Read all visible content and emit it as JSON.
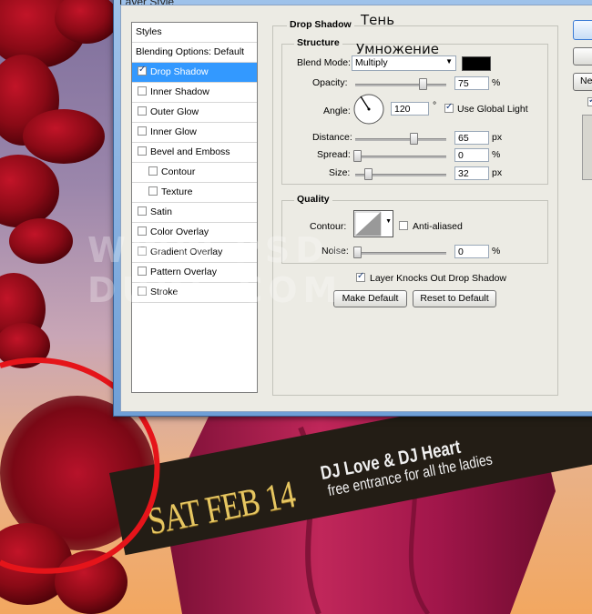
{
  "dialog": {
    "title": "Layer Style"
  },
  "styles_panel": {
    "items": [
      {
        "label": "Styles",
        "checkbox": false,
        "checked": false,
        "selected": false,
        "indent": false
      },
      {
        "label": "Blending Options: Default",
        "checkbox": false,
        "checked": false,
        "selected": false,
        "indent": false
      },
      {
        "label": "Drop Shadow",
        "checkbox": true,
        "checked": true,
        "selected": true,
        "indent": false
      },
      {
        "label": "Inner Shadow",
        "checkbox": true,
        "checked": false,
        "selected": false,
        "indent": false
      },
      {
        "label": "Outer Glow",
        "checkbox": true,
        "checked": false,
        "selected": false,
        "indent": false
      },
      {
        "label": "Inner Glow",
        "checkbox": true,
        "checked": false,
        "selected": false,
        "indent": false
      },
      {
        "label": "Bevel and Emboss",
        "checkbox": true,
        "checked": false,
        "selected": false,
        "indent": false
      },
      {
        "label": "Contour",
        "checkbox": true,
        "checked": false,
        "selected": false,
        "indent": true
      },
      {
        "label": "Texture",
        "checkbox": true,
        "checked": false,
        "selected": false,
        "indent": true
      },
      {
        "label": "Satin",
        "checkbox": true,
        "checked": false,
        "selected": false,
        "indent": false
      },
      {
        "label": "Color Overlay",
        "checkbox": true,
        "checked": false,
        "selected": false,
        "indent": false
      },
      {
        "label": "Gradient Overlay",
        "checkbox": true,
        "checked": false,
        "selected": false,
        "indent": false
      },
      {
        "label": "Pattern Overlay",
        "checkbox": true,
        "checked": false,
        "selected": false,
        "indent": false
      },
      {
        "label": "Stroke",
        "checkbox": true,
        "checked": false,
        "selected": false,
        "indent": false
      }
    ]
  },
  "drop_shadow": {
    "title": "Drop Shadow",
    "structure": {
      "title": "Structure",
      "blend_mode_label": "Blend Mode:",
      "blend_mode_value": "Multiply",
      "shadow_color": "#000000",
      "opacity_label": "Opacity:",
      "opacity_value": "75",
      "opacity_unit": "%",
      "opacity_level": 0.75,
      "angle_label": "Angle:",
      "angle_value": "120",
      "angle_unit": "°",
      "use_global_light_label": "Use Global Light",
      "use_global_light_checked": true,
      "distance_label": "Distance:",
      "distance_value": "65",
      "distance_unit": "px",
      "distance_level": 0.65,
      "spread_label": "Spread:",
      "spread_value": "0",
      "spread_unit": "%",
      "spread_level": 0,
      "size_label": "Size:",
      "size_value": "32",
      "size_unit": "px",
      "size_level": 0.13
    },
    "quality": {
      "title": "Quality",
      "contour_label": "Contour:",
      "anti_aliased_label": "Anti-aliased",
      "anti_aliased_checked": false,
      "noise_label": "Noise:",
      "noise_value": "0",
      "noise_unit": "%",
      "noise_level": 0
    },
    "knocks_out_label": "Layer Knocks Out Drop Shadow",
    "knocks_out_checked": true,
    "make_default_label": "Make Default",
    "reset_default_label": "Reset to Default"
  },
  "right_buttons": {
    "new_style_label": "Ne"
  },
  "annotations": {
    "ten": "Тень",
    "umnozhenie": "Умножение"
  },
  "watermark": "WWW.PSD-DUDE.COM",
  "flyer": {
    "date": "SAT FEB 14",
    "headline": "DJ Love & DJ Heart",
    "subline": "free entrance for all the ladies"
  },
  "colors": {
    "selection": "#3399ff",
    "highlight_circle": "#e5141a",
    "gold_text": "#e6c661"
  }
}
